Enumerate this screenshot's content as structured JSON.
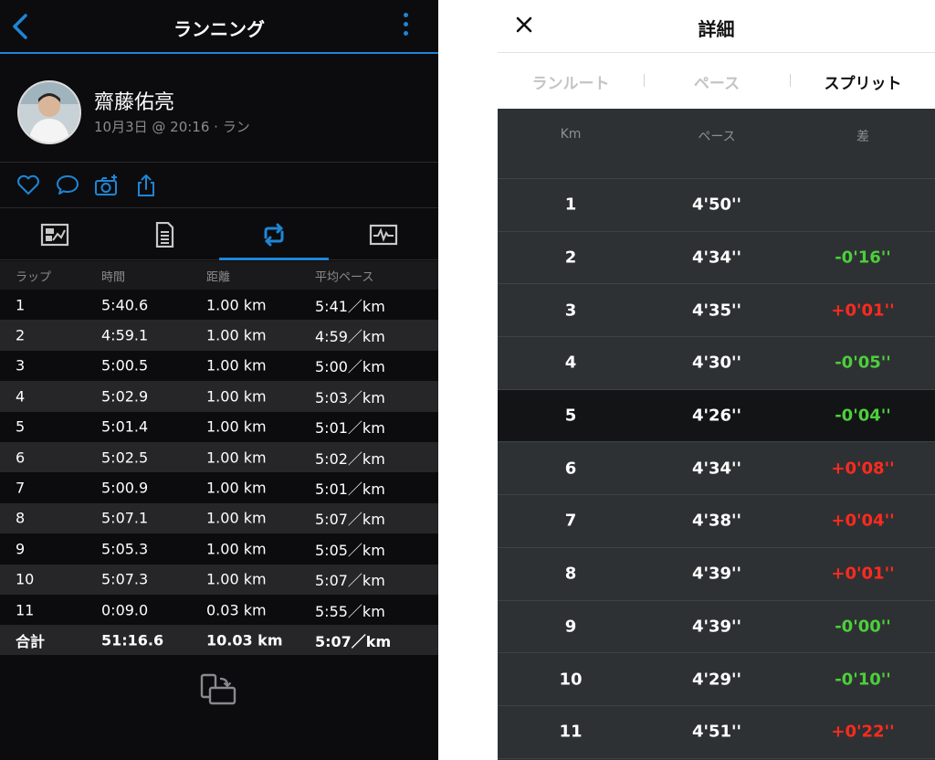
{
  "left": {
    "header": {
      "title": "ランニング"
    },
    "profile": {
      "name": "齋藤佑亮",
      "meta": "10月3日 @ 20:16 · ラン"
    },
    "lap_table": {
      "headers": [
        "ラップ",
        "時間",
        "距離",
        "平均ペース"
      ],
      "rows": [
        [
          "1",
          "5:40.6",
          "1.00 km",
          "5:41／km"
        ],
        [
          "2",
          "4:59.1",
          "1.00 km",
          "4:59／km"
        ],
        [
          "3",
          "5:00.5",
          "1.00 km",
          "5:00／km"
        ],
        [
          "4",
          "5:02.9",
          "1.00 km",
          "5:03／km"
        ],
        [
          "5",
          "5:01.4",
          "1.00 km",
          "5:01／km"
        ],
        [
          "6",
          "5:02.5",
          "1.00 km",
          "5:02／km"
        ],
        [
          "7",
          "5:00.9",
          "1.00 km",
          "5:01／km"
        ],
        [
          "8",
          "5:07.1",
          "1.00 km",
          "5:07／km"
        ],
        [
          "9",
          "5:05.3",
          "1.00 km",
          "5:05／km"
        ],
        [
          "10",
          "5:07.3",
          "1.00 km",
          "5:07／km"
        ],
        [
          "11",
          "0:09.0",
          "0.03 km",
          "5:55／km"
        ]
      ],
      "total": [
        "合計",
        "51:16.6",
        "10.03 km",
        "5:07／km"
      ]
    },
    "icons": {
      "back": "chevron-left-icon",
      "more": "more-vertical-icon",
      "like": "heart-icon",
      "comment": "comment-icon",
      "photo": "camera-add-icon",
      "share": "share-icon",
      "tabs": [
        "summary-chart-icon",
        "details-document-icon",
        "laps-repeat-icon",
        "graph-icon"
      ],
      "switch": "rotate-device-icon"
    },
    "colors": {
      "accent": "#1e86d6",
      "background": "#0c0c0e"
    }
  },
  "right": {
    "header": {
      "title": "詳細"
    },
    "segments": [
      {
        "label": "ランルート",
        "active": false
      },
      {
        "label": "ペース",
        "active": false
      },
      {
        "label": "スプリット",
        "active": true
      }
    ],
    "splits_table": {
      "headers": [
        "Km",
        "ペース",
        "差"
      ],
      "rows": [
        {
          "km": "1",
          "pace": "4'50''",
          "diff": "",
          "sign": ""
        },
        {
          "km": "2",
          "pace": "4'34''",
          "diff": "-0'16''",
          "sign": "neg"
        },
        {
          "km": "3",
          "pace": "4'35''",
          "diff": "+0'01''",
          "sign": "pos"
        },
        {
          "km": "4",
          "pace": "4'30''",
          "diff": "-0'05''",
          "sign": "neg"
        },
        {
          "km": "5",
          "pace": "4'26''",
          "diff": "-0'04''",
          "sign": "neg",
          "highlighted": true
        },
        {
          "km": "6",
          "pace": "4'34''",
          "diff": "+0'08''",
          "sign": "pos"
        },
        {
          "km": "7",
          "pace": "4'38''",
          "diff": "+0'04''",
          "sign": "pos"
        },
        {
          "km": "8",
          "pace": "4'39''",
          "diff": "+0'01''",
          "sign": "pos"
        },
        {
          "km": "9",
          "pace": "4'39''",
          "diff": "-0'00''",
          "sign": "neg"
        },
        {
          "km": "10",
          "pace": "4'29''",
          "diff": "-0'10''",
          "sign": "neg"
        },
        {
          "km": "11",
          "pace": "4'51''",
          "diff": "+0'22''",
          "sign": "pos"
        }
      ]
    },
    "icons": {
      "close": "close-icon"
    },
    "colors": {
      "negative": "#4ccf3c",
      "positive": "#ff2a1f",
      "table_bg": "#2e3133"
    }
  }
}
